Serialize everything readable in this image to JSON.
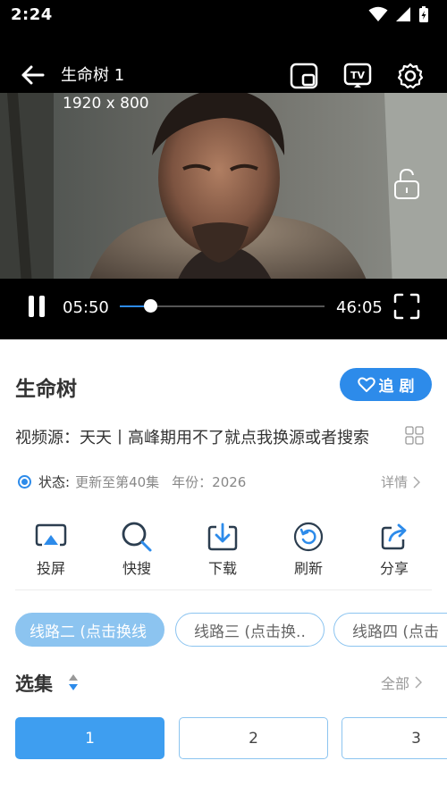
{
  "status_bar": {
    "time": "2:24"
  },
  "player": {
    "title": "生命树 1",
    "resolution": "1920 x 800",
    "current_time": "05:50",
    "total_time": "46:05",
    "progress_fraction": 0.15
  },
  "show": {
    "title": "生命树",
    "follow_label": "追 剧",
    "source_text": "视频源：天天丨高峰期用不了就点我换源或者搜索",
    "status_label": "状态:",
    "status_value": "更新至第40集",
    "year_text": "年份：2026",
    "details_label": "详情"
  },
  "actions": [
    {
      "label": "投屏",
      "icon": "cast-icon"
    },
    {
      "label": "快搜",
      "icon": "search-icon"
    },
    {
      "label": "下载",
      "icon": "download-icon"
    },
    {
      "label": "刷新",
      "icon": "refresh-icon"
    },
    {
      "label": "分享",
      "icon": "share-icon"
    }
  ],
  "lines": [
    {
      "label": "线路二 (点击换线",
      "active": true
    },
    {
      "label": "线路三 (点击换..",
      "active": false
    },
    {
      "label": "线路四 (点击",
      "active": false
    }
  ],
  "episodes_section": {
    "title": "选集",
    "all_label": "全部"
  },
  "episodes": [
    "1",
    "2",
    "3"
  ],
  "colors": {
    "accent": "#2d8bea",
    "accent_light": "#8cc4f0"
  }
}
